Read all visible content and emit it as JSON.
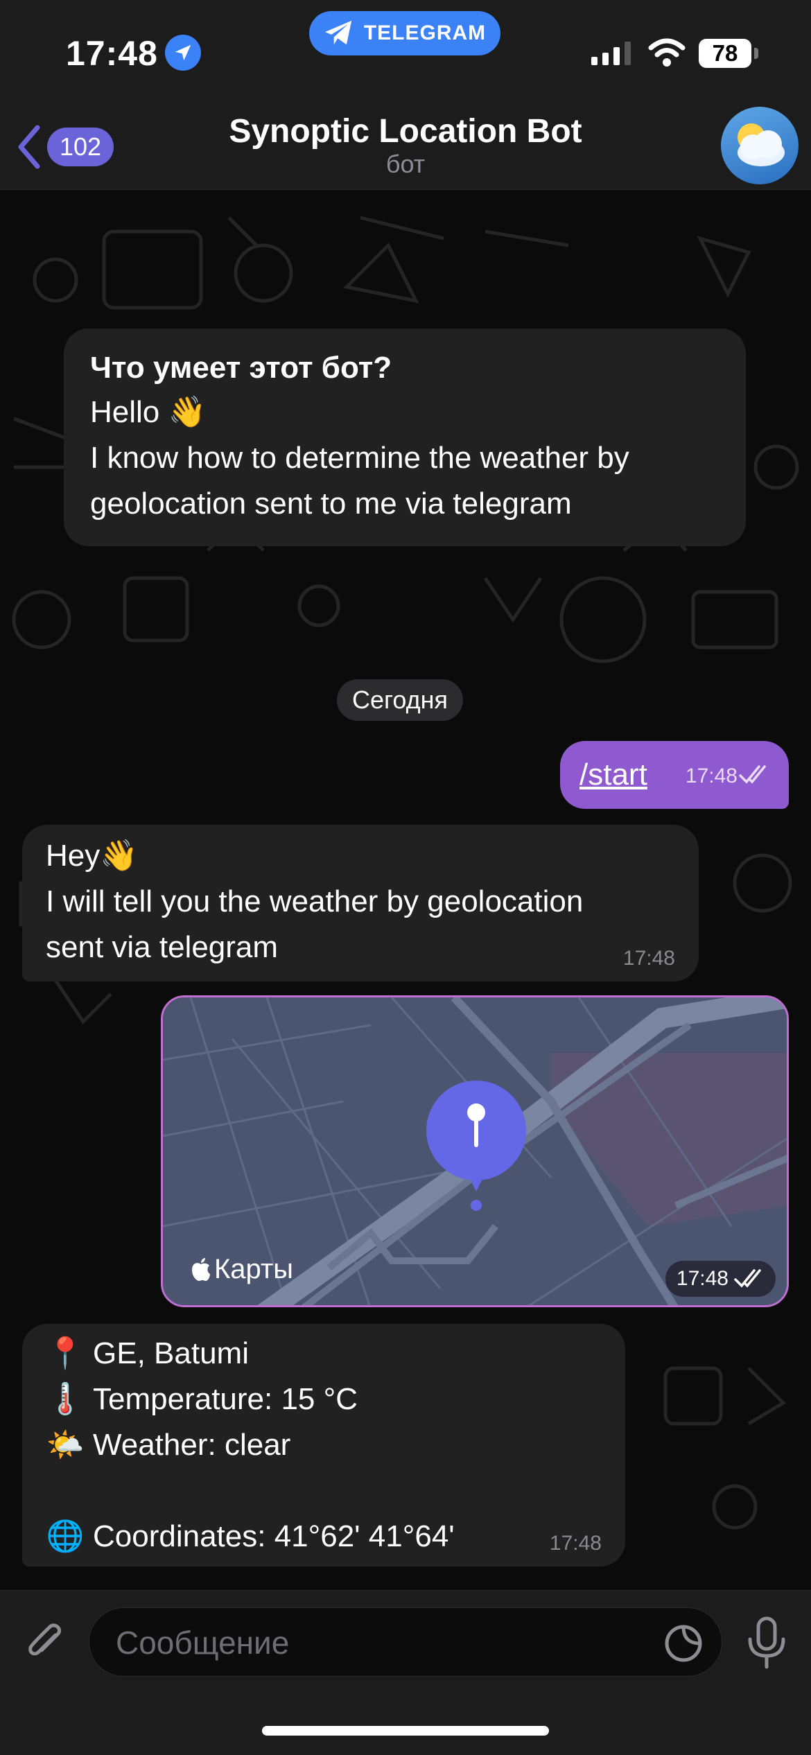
{
  "status_bar": {
    "time": "17:48",
    "app_pill": "TELEGRAM",
    "battery": "78"
  },
  "header": {
    "back_count": "102",
    "title": "Synoptic Location Bot",
    "subtitle": "бот"
  },
  "intro": {
    "heading": "Что умеет этот бот?",
    "line1": "Hello 👋",
    "line2": "I know how to determine the weather by",
    "line3": "geolocation sent to me via telegram"
  },
  "date_chip": "Сегодня",
  "messages": {
    "start": {
      "text": "/start",
      "time": "17:48"
    },
    "hey": {
      "line1": "Hey👋",
      "line2": "I will tell you the weather by geolocation",
      "line3": "sent via telegram",
      "time": "17:48"
    },
    "map": {
      "label": "Карты",
      "time": "17:48"
    },
    "weather": {
      "location": "GE, Batumi",
      "temperature": "Temperature: 15 °C",
      "condition": "Weather: clear",
      "coordinates": "Coordinates: 41°62' 41°64'",
      "time": "17:48"
    }
  },
  "input": {
    "placeholder": "Сообщение"
  },
  "colors": {
    "accent": "#6b63d8",
    "outgoing_bubble": "#8f5ad0",
    "incoming_bubble": "#212121",
    "telegram_blue": "#3a82f6"
  }
}
